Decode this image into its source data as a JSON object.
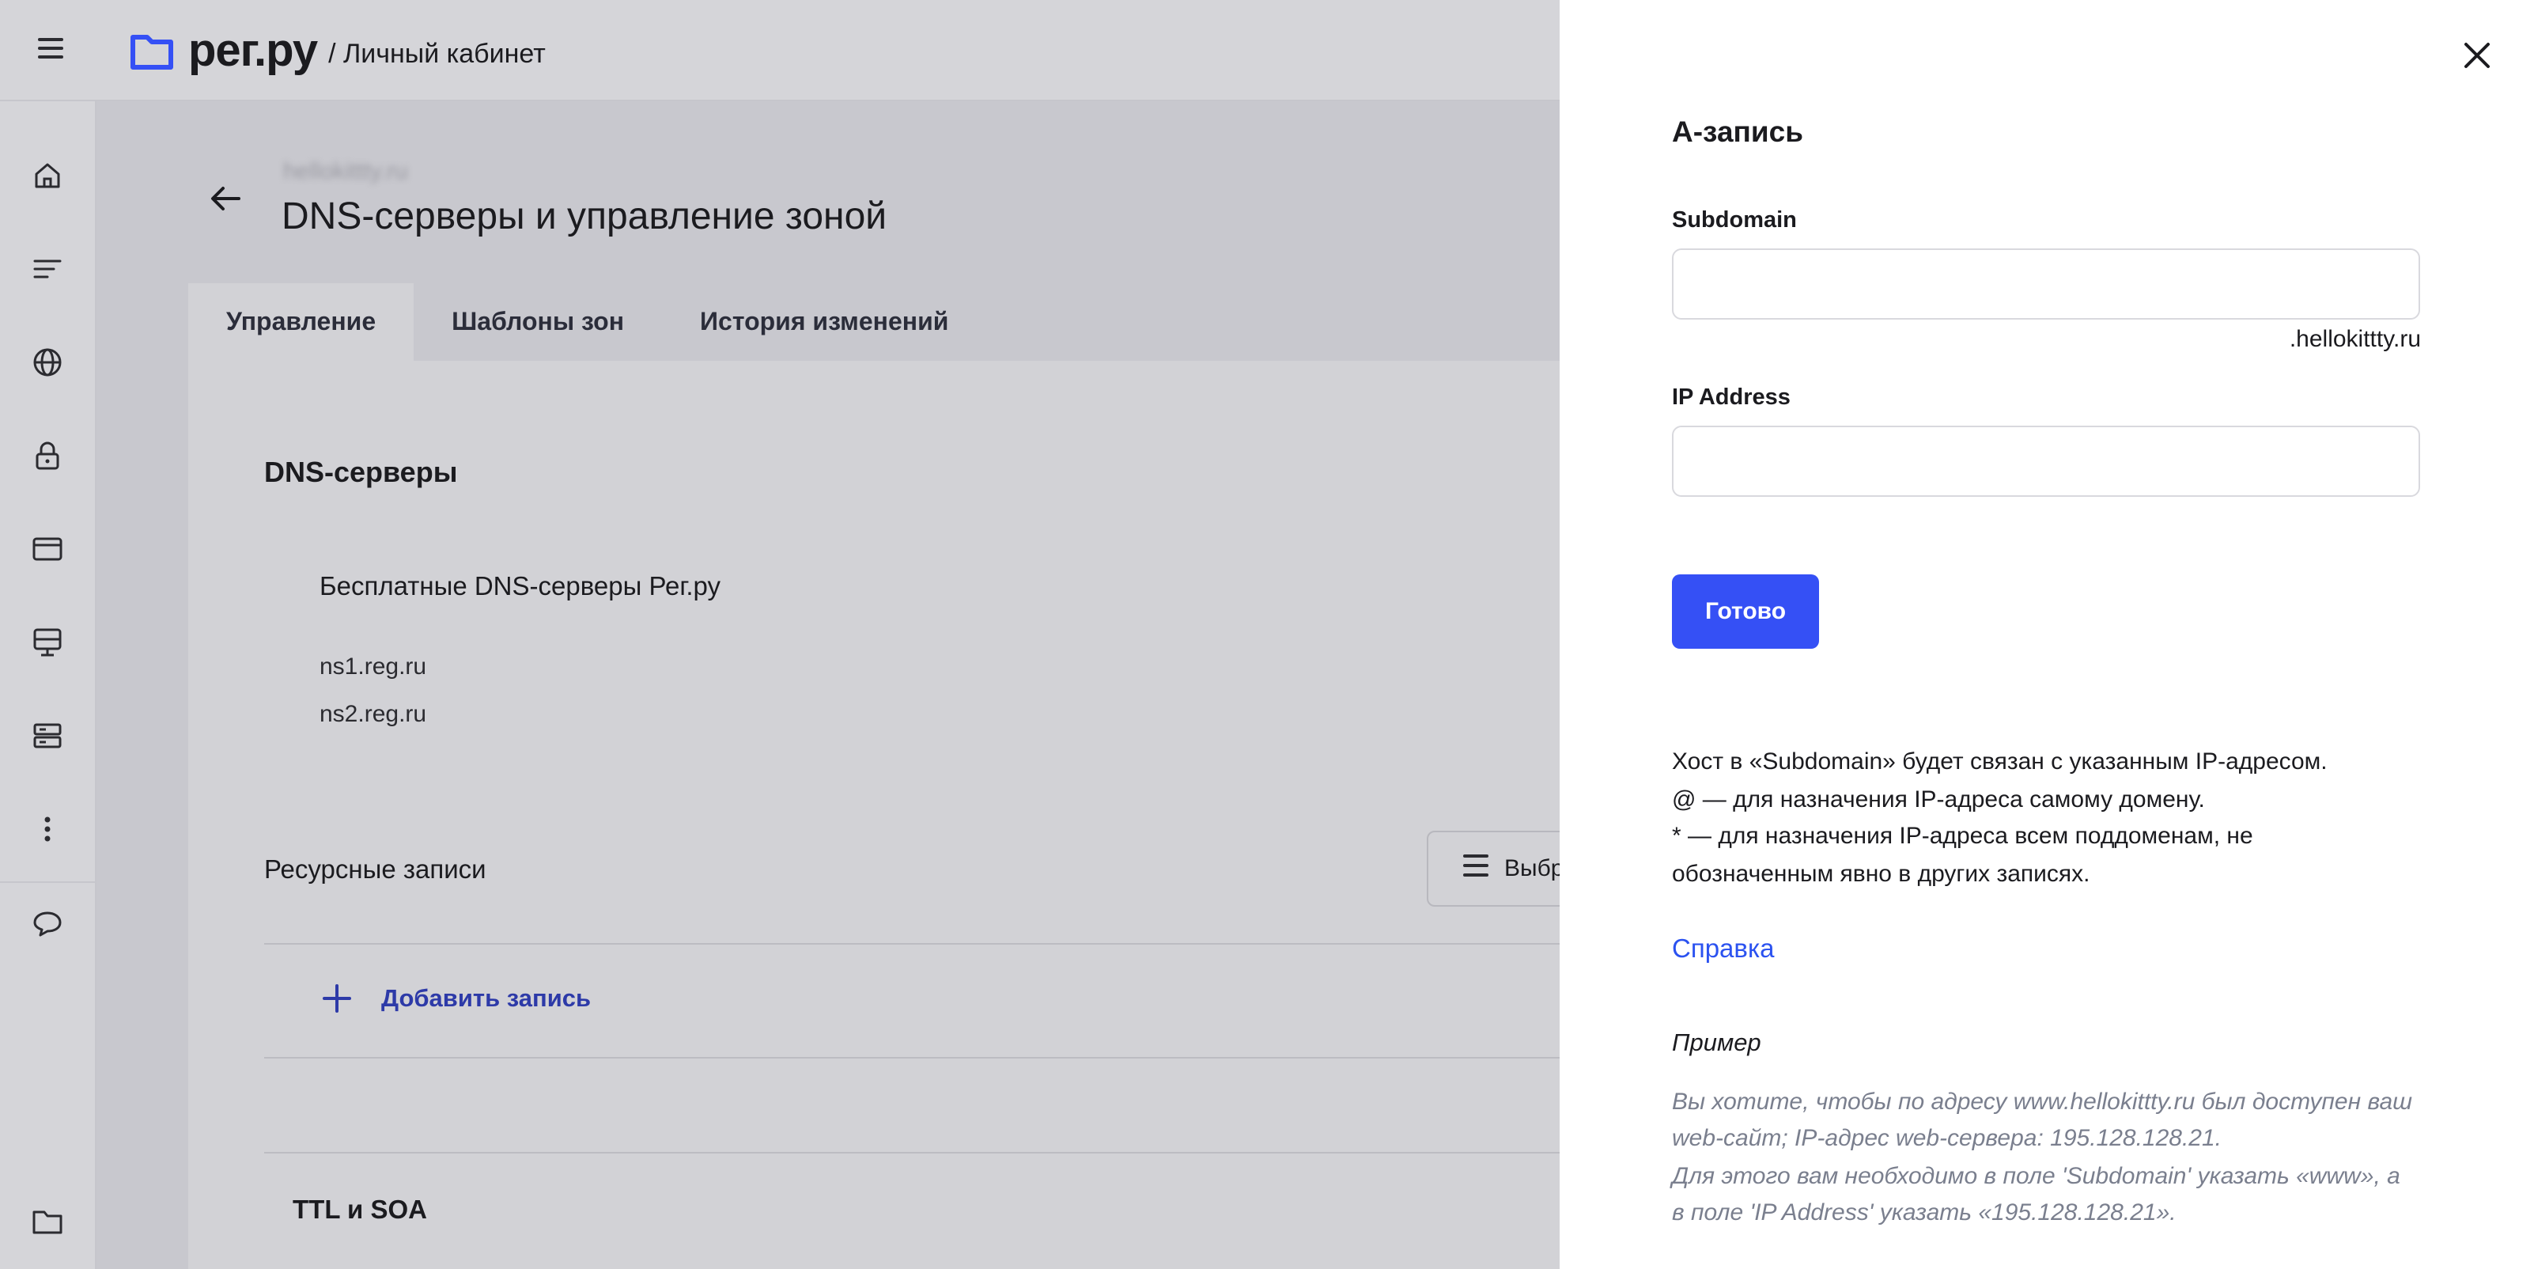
{
  "header": {
    "brand": "рег.ру",
    "section": "/ Личный кабинет"
  },
  "rail": {
    "icons": [
      "home-icon",
      "list-icon",
      "globe-icon",
      "lock-icon",
      "browser-window-icon",
      "monitor-icon",
      "server-icon",
      "more-icon",
      "chat-icon",
      "folder-icon"
    ]
  },
  "page": {
    "domain": "hellokittty.ru",
    "title": "DNS-серверы и управление зоной",
    "tabs": [
      "Управление",
      "Шаблоны зон",
      "История изменений"
    ]
  },
  "dns": {
    "section_title": "DNS-серверы",
    "servers_label": "Бесплатные DNS-серверы Рег.ру",
    "ns1": "ns1.reg.ru",
    "ns2": "ns2.reg.ru"
  },
  "records": {
    "section_title": "Ресурсные записи",
    "select_label": "Выбр",
    "add_label": "Добавить запись"
  },
  "ttl": {
    "section_title": "TTL и SOA"
  },
  "panel": {
    "title": "A-запись",
    "subdomain_label": "Subdomain",
    "subdomain_value": "",
    "subdomain_suffix": ".hellokittty.ru",
    "ip_label": "IP Address",
    "ip_value": "",
    "done_label": "Готово",
    "info_1": "Хост в «Subdomain» будет связан с указанным IP-адресом.",
    "info_2": "@ — для назначения IP-адреса самому домену.",
    "info_3": "* — для назначения IP-адреса всем поддоменам, не",
    "info_4": "обозначенным явно в других записях.",
    "help_link": "Справка",
    "example_heading": "Пример",
    "example_1": "Вы хотите, чтобы по адресу www.hellokittty.ru был доступен ваш",
    "example_2": "web-сайт; IP-адрес web-сервера: 195.128.128.21.",
    "example_3": "Для этого вам необходимо в поле 'Subdomain' указать «www», а",
    "example_4": "в поле 'IP Address' указать «195.128.128.21»."
  },
  "colors": {
    "accent": "#3550f5",
    "link": "#2b52f0",
    "dim_overlay": "#d2d2d6"
  }
}
